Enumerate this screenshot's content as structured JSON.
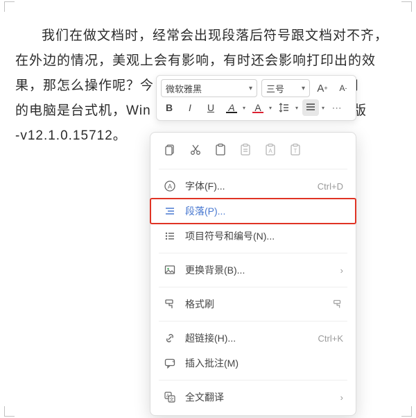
{
  "doc": {
    "paragraph": "我们在做文档时，经常会出现段落后符号跟文档对不齐，在外边的情况，美观上会有影响，有时还会影响打印出的效果，那怎么操作呢？今",
    "frag2a": "用",
    "frag2b": "的电脑是台式机，Win",
    "frag2c": "版",
    "frag2d": "-v12.1.0.15712。"
  },
  "toolbar": {
    "font_name": "微软雅黑",
    "font_size": "三号",
    "inc_font": "A",
    "dec_font": "A",
    "bold": "B",
    "italic": "I",
    "underline": "U",
    "highlight": "A",
    "font_color": "A"
  },
  "menu": {
    "font": "字体(F)...",
    "font_sc": "Ctrl+D",
    "paragraph": "段落(P)...",
    "bullets": "项目符号和编号(N)...",
    "background": "更换背景(B)...",
    "format_painter": "格式刷",
    "hyperlink": "超链接(H)...",
    "hyperlink_sc": "Ctrl+K",
    "comment": "插入批注(M)",
    "translate": "全文翻译"
  }
}
